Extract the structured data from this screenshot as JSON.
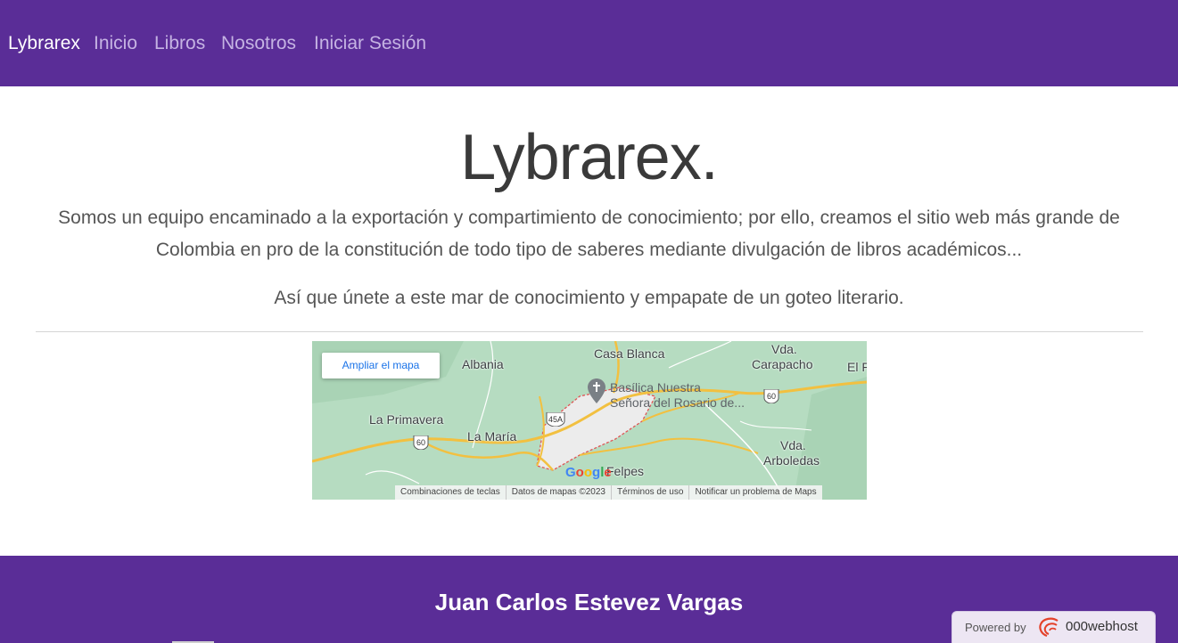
{
  "navbar": {
    "brand": "Lybrarex",
    "links": [
      "Inicio",
      "Libros",
      "Nosotros",
      "Iniciar Sesión"
    ]
  },
  "hero": {
    "title": "Lybrarex.",
    "description": "Somos un equipo encaminado a la exportación y compartimiento de conocimiento; por ello, creamos el sitio web más grande de Colombia en pro de la constitución de todo tipo de saberes mediante divulgación de libros académicos...",
    "invitation": "Así que únete a este mar de conocimiento y empapate de un goteo literario."
  },
  "map": {
    "enlarge_button": "Ampliar el mapa",
    "labels": {
      "casa_blanca": "Casa Blanca",
      "vda_top": "Vda.",
      "carapacho": "Carapacho",
      "el_f": "El F",
      "albania": "Albania",
      "la_primavera": "La Primavera",
      "la_maria": "La María",
      "vda_bottom": "Vda.",
      "arboledas": "Arboledas",
      "felpes": "Felpes"
    },
    "place": {
      "line1": "Basílica Nuestra",
      "line2": "Señora del Rosario de..."
    },
    "route_shields": [
      "60",
      "45A",
      "60"
    ],
    "logo": [
      "G",
      "o",
      "o",
      "g",
      "l",
      "e"
    ],
    "footer_links": [
      "Combinaciones de teclas",
      "Datos de mapas ©2023",
      "Términos de uso",
      "Notificar un problema de Maps"
    ],
    "colors": {
      "land": "#b6dcc1",
      "roads": "#f2c040",
      "urban": "#ececec",
      "boundary": "#e05555"
    }
  },
  "footer": {
    "name": "Juan Carlos Estevez Vargas"
  },
  "badge": {
    "powered_by": "Powered by",
    "host": "000webhost"
  },
  "colors": {
    "primary": "#5a2d97",
    "nav_link": "#c5b3e3",
    "text": "#555555"
  }
}
